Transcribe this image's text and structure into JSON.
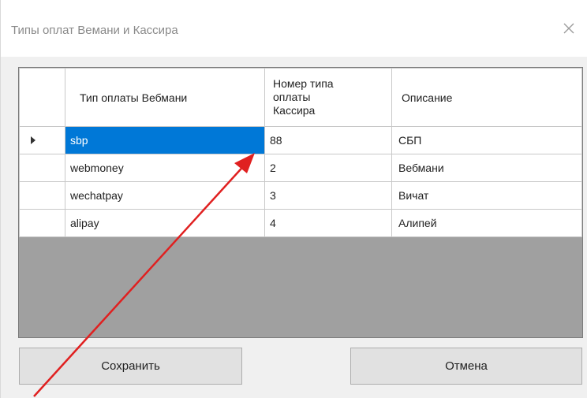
{
  "window": {
    "title": "Типы оплат Вемани и Кассира"
  },
  "grid": {
    "columns": [
      "Тип оплаты Вебмани",
      "Номер типа оплаты Кассира",
      "Описание"
    ],
    "column2_lines": [
      "Номер типа",
      "оплаты",
      "Кассира"
    ],
    "rows": [
      {
        "type": "sbp",
        "number": "88",
        "description": "СБП",
        "current": true
      },
      {
        "type": "webmoney",
        "number": "2",
        "description": "Вебмани",
        "current": false
      },
      {
        "type": "wechatpay",
        "number": "3",
        "description": "Вичат",
        "current": false
      },
      {
        "type": "alipay",
        "number": "4",
        "description": "Алипей",
        "current": false
      }
    ]
  },
  "buttons": {
    "save_label": "Сохранить",
    "cancel_label": "Отмена"
  },
  "colors": {
    "selection": "#0078d7",
    "annotation_arrow": "#e02020"
  }
}
